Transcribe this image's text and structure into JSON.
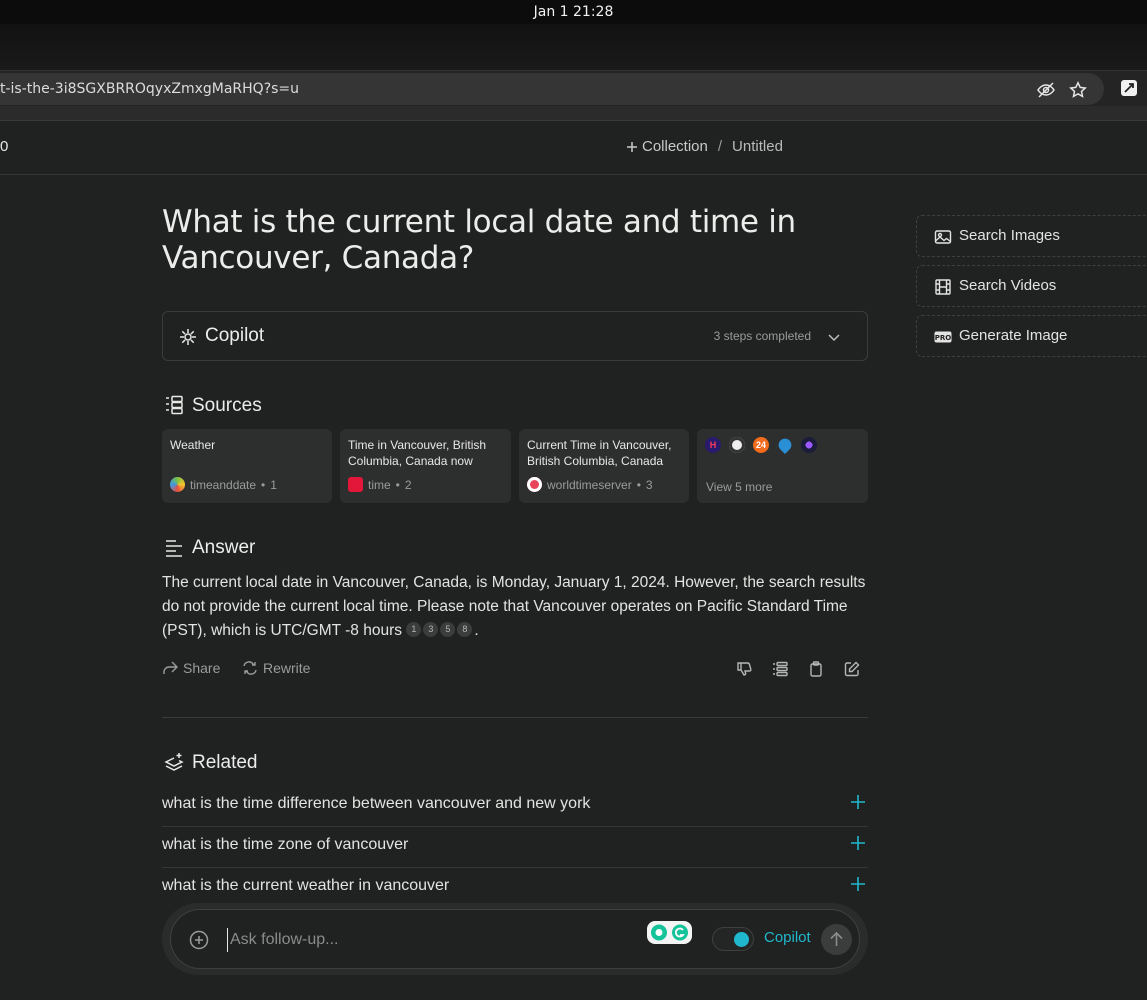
{
  "os": {
    "clock": "Jan 1  21:28"
  },
  "browser": {
    "url": "t-is-the-3i8SGXBRROqyxZmxgMaRHQ?s=u"
  },
  "header": {
    "left_text": "0",
    "collection_label": "Collection",
    "separator": "/",
    "page_name": "Untitled"
  },
  "query": {
    "title": "What is the current local date and time in Vancouver, Canada?"
  },
  "copilot": {
    "label": "Copilot",
    "steps": "3 steps completed"
  },
  "sources": {
    "title": "Sources",
    "items": [
      {
        "title": "Weather",
        "site": "timeanddate",
        "index": "1"
      },
      {
        "title": "Time in Vancouver, British Columbia, Canada now",
        "site": "time",
        "index": "2"
      },
      {
        "title": "Current Time in Vancouver, British Columbia, Canada",
        "site": "worldtimeserver",
        "index": "3"
      }
    ],
    "more_favicon_badge": "24",
    "view_more": "View 5 more"
  },
  "answer": {
    "title": "Answer",
    "text": "The current local date in Vancouver, Canada, is Monday, January 1, 2024. However, the search results do not provide the current local time. Please note that Vancouver operates on Pacific Standard Time (PST), which is UTC/GMT -8 hours",
    "citations": [
      "1",
      "3",
      "5",
      "8"
    ],
    "end": ".",
    "share_label": "Share",
    "rewrite_label": "Rewrite"
  },
  "related": {
    "title": "Related",
    "items": [
      "what is the time difference between vancouver and new york",
      "what is the time zone of vancouver",
      "what is the current weather in vancouver"
    ]
  },
  "followup": {
    "placeholder": "Ask follow-up...",
    "copilot_label": "Copilot",
    "copilot_on": true
  },
  "rail": {
    "search_images": "Search Images",
    "search_videos": "Search Videos",
    "generate_image": "Generate Image",
    "pro_badge": "PRO"
  },
  "colors": {
    "accent": "#20b8cd",
    "background": "#202222",
    "card": "#2d2f2f"
  }
}
